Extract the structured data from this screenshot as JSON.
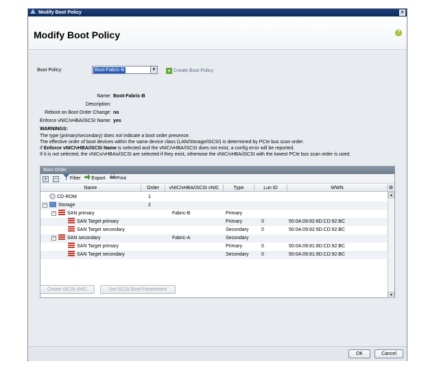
{
  "window": {
    "title": "Modify Boot Policy",
    "close_glyph": "✕"
  },
  "header": {
    "title": "Modify Boot Policy",
    "help_glyph": "?"
  },
  "boot_policy": {
    "label": "Boot Policy:",
    "selected": "Boot-Fabric-B",
    "create_label": "Create Boot Policy"
  },
  "info": {
    "name_label": "Name:",
    "name_value": "Boot-Fabric-B",
    "description_label": "Description:",
    "description_value": "",
    "reboot_label": "Reboot on Boot Order Change:",
    "reboot_value": "no",
    "enforce_label": "Enforce vNIC/vHBA/iSCSI Name:",
    "enforce_value": "yes"
  },
  "warnings": {
    "heading": "WARNINGS:",
    "line1": "The type (primary/secondary) does not indicate a boot order presence.",
    "line2": "The effective order of boot devices within the same device class (LAN/Storage/iSCSI) is determined by PCIe bus scan order.",
    "line3_pre": "If ",
    "line3_bold": "Enforce vNIC/vHBA/iSCSI Name",
    "line3_post": " is selected and the vNIC/vHBA/iSCSI does not exist, a config error will be reported.",
    "line4": "If it is not selected, the vNICs/vHBAs/iSCSI are selected if they exist, otherwise the vNIC/vHBA/iSCSI with the lowest PCIe bus scan order is used."
  },
  "boot_order": {
    "panel_title": "Boot Order",
    "toolbar": {
      "add": "+",
      "remove": "−",
      "filter": "Filter",
      "export": "Export",
      "print": "Print"
    },
    "columns": {
      "name": "Name",
      "order": "Order",
      "vnic": "vNIC/vHBA/iSCSI vNIC",
      "type": "Type",
      "lun": "Lun ID",
      "wwn": "WWN"
    },
    "rows": [
      {
        "name": "CD-ROM",
        "order": "1",
        "vnic": "",
        "type": "",
        "lun": "",
        "wwn": ""
      },
      {
        "name": "Storage",
        "order": "2",
        "vnic": "",
        "type": "",
        "lun": "",
        "wwn": ""
      },
      {
        "name": "SAN primary",
        "order": "",
        "vnic": "Fabric-B",
        "type": "Primary",
        "lun": "",
        "wwn": ""
      },
      {
        "name": "SAN Target primary",
        "order": "",
        "vnic": "",
        "type": "Primary",
        "lun": "0",
        "wwn": "50:0A:09:82:8D:CD:92:BC"
      },
      {
        "name": "SAN Target secondary",
        "order": "",
        "vnic": "",
        "type": "Secondary",
        "lun": "0",
        "wwn": "50:0A:09:82:9D:CD:92:BC"
      },
      {
        "name": "SAN secondary",
        "order": "",
        "vnic": "Fabric-A",
        "type": "Secondary",
        "lun": "",
        "wwn": ""
      },
      {
        "name": "SAN Target primary",
        "order": "",
        "vnic": "",
        "type": "Primary",
        "lun": "0",
        "wwn": "50:0A:09:81:8D:CD:92:BC"
      },
      {
        "name": "SAN Target secondary",
        "order": "",
        "vnic": "",
        "type": "Secondary",
        "lun": "0",
        "wwn": "50:0A:09:81:9D:CD:92:BC"
      }
    ]
  },
  "buttons": {
    "create_iscsi": "Create iSCSI vNIC",
    "set_iscsi": "Set iSCSI Boot Parameters",
    "ok": "OK",
    "cancel": "Cancel"
  }
}
